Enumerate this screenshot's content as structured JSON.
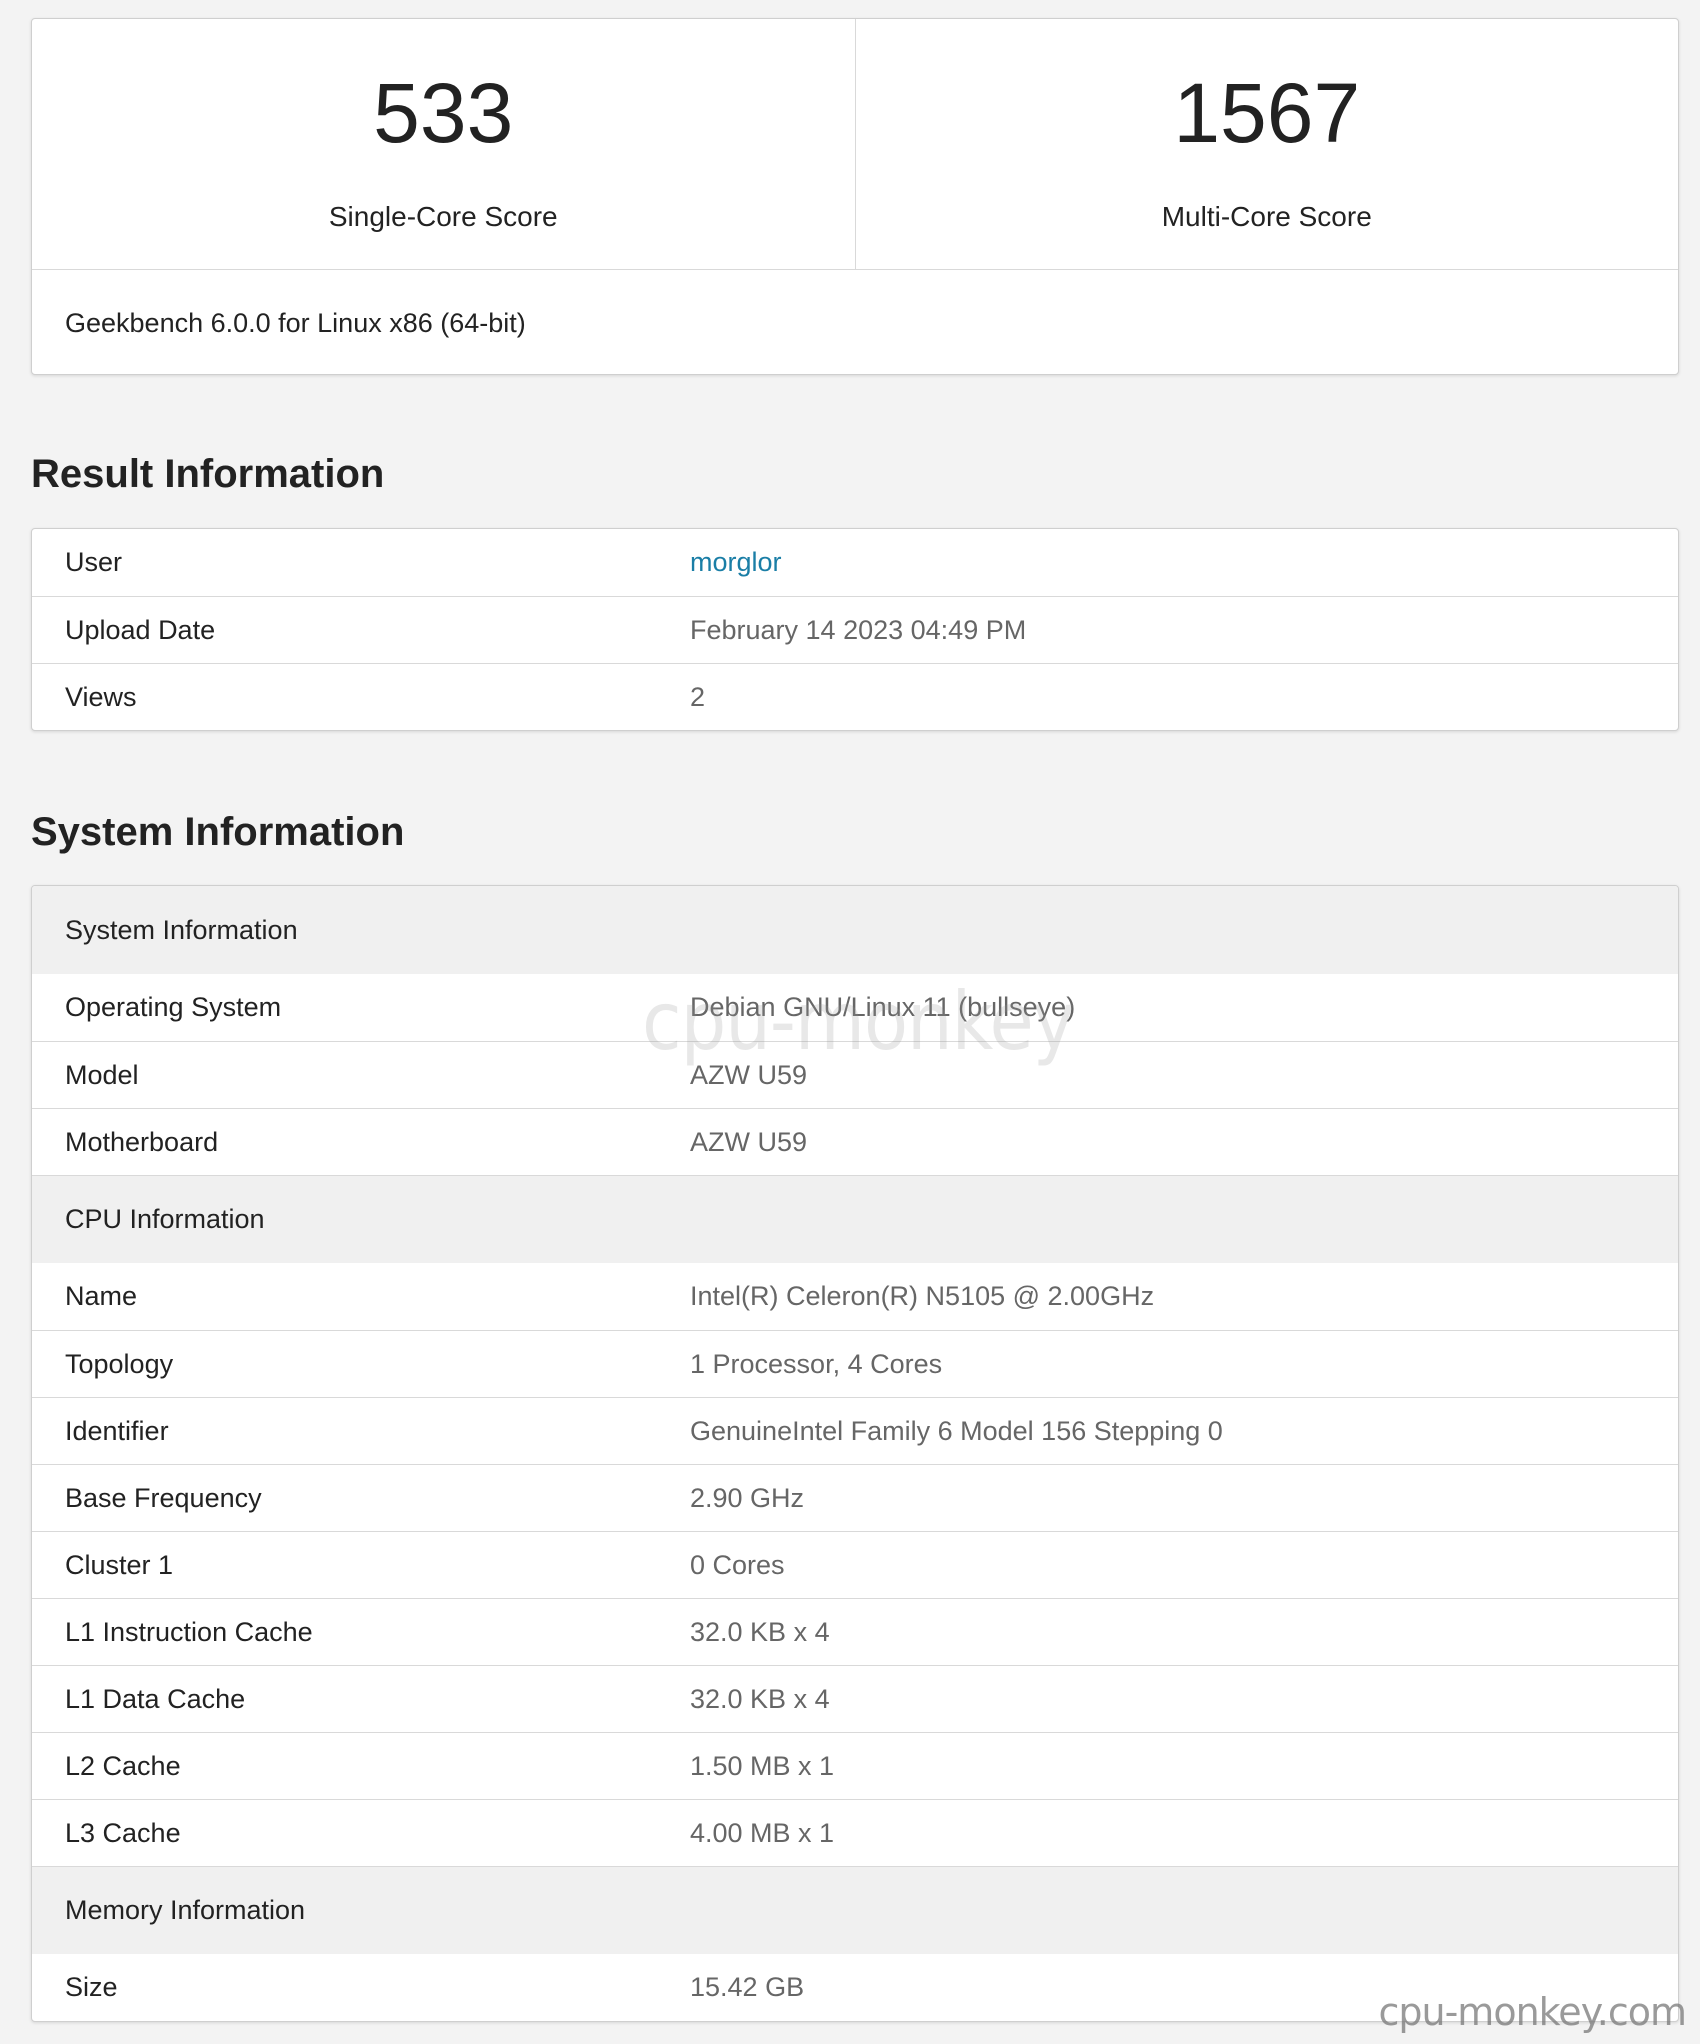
{
  "scores": {
    "single_core": {
      "value": "533",
      "label": "Single-Core Score"
    },
    "multi_core": {
      "value": "1567",
      "label": "Multi-Core Score"
    },
    "version": "Geekbench 6.0.0 for Linux x86 (64-bit)"
  },
  "result_information": {
    "title": "Result Information",
    "rows": [
      {
        "label": "User",
        "value": "morglor"
      },
      {
        "label": "Upload Date",
        "value": "February 14 2023 04:49 PM"
      },
      {
        "label": "Views",
        "value": "2"
      }
    ]
  },
  "system_information": {
    "title": "System Information",
    "sections": [
      {
        "heading": "System Information",
        "rows": [
          {
            "label": "Operating System",
            "value": "Debian GNU/Linux 11 (bullseye)"
          },
          {
            "label": "Model",
            "value": "AZW U59"
          },
          {
            "label": "Motherboard",
            "value": "AZW U59"
          }
        ]
      },
      {
        "heading": "CPU Information",
        "rows": [
          {
            "label": "Name",
            "value": "Intel(R) Celeron(R) N5105 @ 2.00GHz"
          },
          {
            "label": "Topology",
            "value": "1 Processor, 4 Cores"
          },
          {
            "label": "Identifier",
            "value": "GenuineIntel Family 6 Model 156 Stepping 0"
          },
          {
            "label": "Base Frequency",
            "value": "2.90 GHz"
          },
          {
            "label": "Cluster 1",
            "value": "0 Cores"
          },
          {
            "label": "L1 Instruction Cache",
            "value": "32.0 KB x 4"
          },
          {
            "label": "L1 Data Cache",
            "value": "32.0 KB x 4"
          },
          {
            "label": "L2 Cache",
            "value": "1.50 MB x 1"
          },
          {
            "label": "L3 Cache",
            "value": "4.00 MB x 1"
          }
        ]
      },
      {
        "heading": "Memory Information",
        "rows": [
          {
            "label": "Size",
            "value": "15.42 GB"
          }
        ]
      }
    ]
  },
  "watermarks": {
    "center": "cpu-monkey",
    "corner": "cpu-monkey.com"
  }
}
